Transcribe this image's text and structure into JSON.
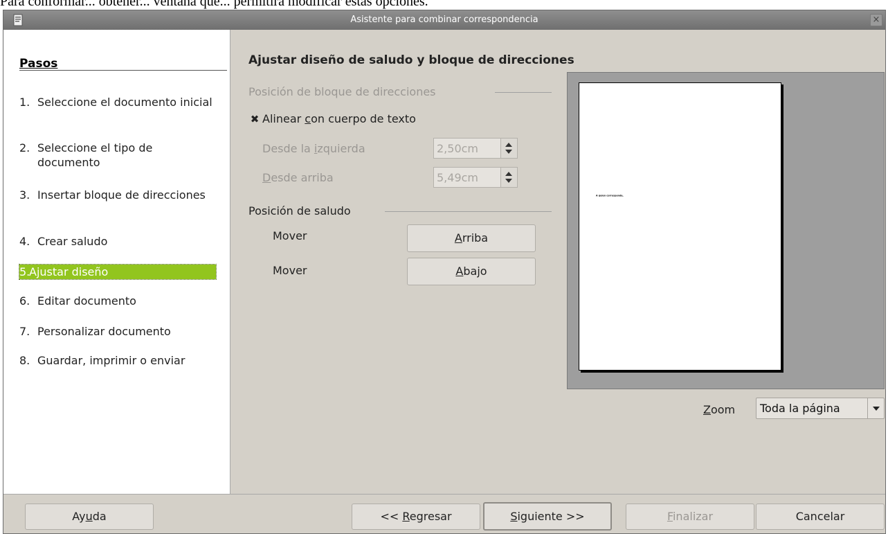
{
  "top_text": "Para conformar...    obtener...    ventana que...    permitirá    modificar estas opciones.",
  "window": {
    "title": "Asistente para combinar correspondencia",
    "close_glyph": "×"
  },
  "sidebar": {
    "title": "Pasos",
    "steps": [
      {
        "num": "1.",
        "label": "Seleccione el documento inicial"
      },
      {
        "num": "2.",
        "label": "Seleccione el tipo de documento"
      },
      {
        "num": "3.",
        "label": "Insertar bloque de direcciones"
      },
      {
        "num": "4.",
        "label": "Crear saludo"
      },
      {
        "num": "5.",
        "label": "Ajustar diseño"
      },
      {
        "num": "6.",
        "label": "Editar documento"
      },
      {
        "num": "7.",
        "label": "Personalizar documento"
      },
      {
        "num": "8.",
        "label": "Guardar, imprimir o enviar"
      }
    ],
    "active_step": 5,
    "active_color": "#92c51e"
  },
  "main": {
    "heading": "Ajustar diseño de saludo y bloque de direcciones",
    "address_block": {
      "title": "Posición de bloque de direcciones",
      "align_label_pre": "Alinear ",
      "align_label_ul": "c",
      "align_label_post": "on cuerpo de texto",
      "align_checked": true,
      "from_left_pre": "Desde la ",
      "from_left_ul": "i",
      "from_left_post": "zquierda",
      "from_left_value": "2,50cm",
      "from_top_ul": "D",
      "from_top_post": "esde arriba",
      "from_top_value": "5,49cm"
    },
    "salutation": {
      "title": "Posición de saludo",
      "move_label_1": "Mover",
      "up_ul": "A",
      "up_post": "rriba",
      "move_label_2": "Mover",
      "down_ul": "A",
      "down_post": "bajo"
    },
    "preview": {
      "salutation_text": "A quien corresponda,"
    },
    "zoom": {
      "label_ul": "Z",
      "label_post": "oom",
      "value": "Toda la página"
    }
  },
  "footer": {
    "help_pre": "Ay",
    "help_ul": "u",
    "help_post": "da",
    "back_pre": "<< ",
    "back_ul": "R",
    "back_post": "egresar",
    "next_ul": "S",
    "next_post": "iguiente >>",
    "finish_ul": "F",
    "finish_post": "inalizar",
    "cancel": "Cancelar"
  }
}
